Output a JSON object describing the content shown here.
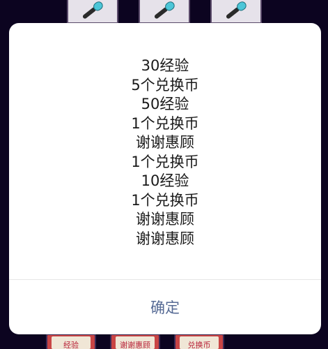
{
  "dialog": {
    "rewards": [
      "30经验",
      "5个兑换币",
      "50经验",
      "1个兑换币",
      "谢谢惠顾",
      "1个兑换币",
      "10经验",
      "1个兑换币",
      "谢谢惠顾",
      "谢谢惠顾"
    ],
    "confirm_label": "确定",
    "confirm_color": "#576b95"
  },
  "background": {
    "top_tiles_icon": "microphone-icon",
    "bottom_tiles": [
      {
        "label": "经验"
      },
      {
        "label": "谢谢惠顾"
      },
      {
        "label": "兑换币"
      }
    ]
  }
}
